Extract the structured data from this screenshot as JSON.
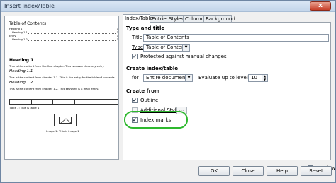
{
  "window": {
    "title": "Insert Index/Table",
    "close_glyph": "x"
  },
  "preview": {
    "toc_title": "Table of Contents",
    "toc_lines": [
      {
        "text": "Heading 1",
        "page": "1"
      },
      {
        "text": "Heading 1.1",
        "page": "1"
      },
      {
        "text": "Entry",
        "page": "1"
      },
      {
        "text": "Heading 1.2",
        "page": "1"
      }
    ],
    "heading1": "Heading 1",
    "text1": "This is the content from the first chapter. This is a user directory entry.",
    "heading11": "Heading 1.1",
    "text11": "This is the content from chapter 1.1. This is the entry for the table of contents.",
    "heading12": "Heading 1.2",
    "text12": "This is the content from chapter 1.2. This keyword is a main entry.",
    "table_caption": "Table 1: This is table 1",
    "image_caption": "Image 1: This is image 1"
  },
  "tabs": [
    {
      "label": "Index/Table"
    },
    {
      "label": "Entries"
    },
    {
      "label": "Styles"
    },
    {
      "label": "Columns"
    },
    {
      "label": "Background"
    }
  ],
  "type_and_title": {
    "section": "Type and title",
    "title_label": "Title",
    "title_value": "Table of Contents",
    "type_label": "Type",
    "type_value": "Table of Contents",
    "protected_label": "Protected against manual changes",
    "protected_checked": true
  },
  "create_index": {
    "section": "Create index/table",
    "for_label": "for",
    "for_value": "Entire document",
    "evaluate_label": "Evaluate up to level",
    "level_value": "10"
  },
  "create_from": {
    "section": "Create from",
    "outline_label": "Outline",
    "outline_checked": true,
    "additional_styles_label": "Additional Styles",
    "additional_styles_checked": false,
    "styles_button_label": "...",
    "index_marks_label": "Index marks",
    "index_marks_checked": true
  },
  "preview_toggle": {
    "label": "Preview",
    "checked": true
  },
  "buttons": {
    "ok": "OK",
    "close": "Close",
    "help": "Help",
    "reset": "Reset"
  },
  "colors": {
    "highlight": "#2eb82e",
    "titlebar": "#c3d5ea"
  }
}
